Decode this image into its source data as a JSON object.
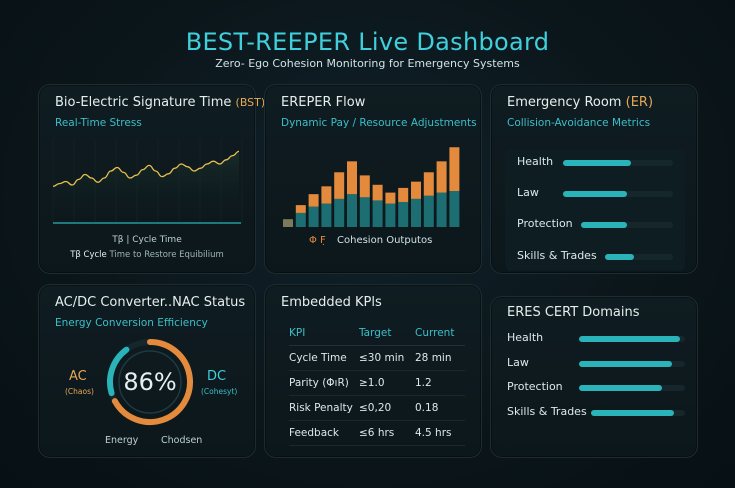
{
  "header": {
    "title": "BEST-REEPER Live Dashboard",
    "subtitle": "Zero- Ego Cohesion Monitoring for Emergency Systems"
  },
  "bst_panel": {
    "title": "Bio-Electric Signature Time",
    "title_accent": "(BST)",
    "subtitle": "Real-Time Stress",
    "legend_1": "Tβ | Cycle Time",
    "legend_2_prefix": "Tβ Cycle",
    "legend_2": "Time to Restore Equibilium",
    "line_color": "#e7c04e",
    "wave": [
      0.62,
      0.58,
      0.55,
      0.6,
      0.52,
      0.45,
      0.5,
      0.56,
      0.5,
      0.4,
      0.35,
      0.42,
      0.5,
      0.46,
      0.38,
      0.32,
      0.4,
      0.48,
      0.44,
      0.36,
      0.3,
      0.34,
      0.4,
      0.36,
      0.3,
      0.26,
      0.3,
      0.24,
      0.18,
      0.12
    ]
  },
  "ereper_panel": {
    "title": "EREPER Flow",
    "subtitle": "Dynamic Pay / Resource Adjustments",
    "legend_symbol": "Φ F̣",
    "legend_label": "Cohesion Outputos",
    "colors": {
      "base": "#1d6e72",
      "top": "#e48a3c"
    },
    "chart_data": {
      "type": "bar",
      "stacked": true,
      "series": [
        {
          "values": [
            10,
            18,
            26,
            30,
            36,
            42,
            38,
            34,
            30,
            32,
            36,
            40,
            44,
            46
          ]
        },
        {
          "values": [
            0,
            10,
            16,
            22,
            34,
            42,
            28,
            20,
            14,
            18,
            22,
            30,
            40,
            56
          ]
        }
      ]
    }
  },
  "er_panel": {
    "title": "Emergency Room",
    "title_accent": "(ER)",
    "subtitle": "Collision-Avoidance Metrics",
    "items": [
      {
        "label": "Health",
        "value": 0.62
      },
      {
        "label": "Law",
        "value": 0.58
      },
      {
        "label": "Protection",
        "value": 0.5
      },
      {
        "label": "Skills & Trades",
        "value": 0.42
      }
    ]
  },
  "acdc_panel": {
    "title": "AC/DC Converter..NAC Status",
    "subtitle": "Energy Conversion Efficiency",
    "value_text": "86%",
    "value": 0.86,
    "left_label": "AC",
    "left_sub": "(Chaos)",
    "right_label": "DC",
    "right_sub": "(Cohesyt)",
    "bottom_left": "Energy",
    "bottom_right": "Chodsen",
    "ring_colors": {
      "a": "#e48a3c",
      "b": "#2ab3b8"
    }
  },
  "kpi_panel": {
    "title": "Embedded KPls",
    "headers": [
      "KPI",
      "Target",
      "Current"
    ],
    "rows": [
      [
        "Cycle Time",
        "≤30 min",
        "28 min"
      ],
      [
        "Parity (ΦıR)",
        "≥1.0",
        "1.2"
      ],
      [
        "Risk Penalty",
        "≤0,20",
        "0.18"
      ],
      [
        "Feedback",
        "≤6 hrs",
        "4.5 hrs"
      ]
    ]
  },
  "eres_panel": {
    "title": "ERES CERT Domains",
    "items": [
      {
        "label": "Health",
        "value": 0.95
      },
      {
        "label": "Law",
        "value": 0.88
      },
      {
        "label": "Protection",
        "value": 0.78
      },
      {
        "label": "Skills & Trades",
        "value": 0.88
      }
    ]
  }
}
